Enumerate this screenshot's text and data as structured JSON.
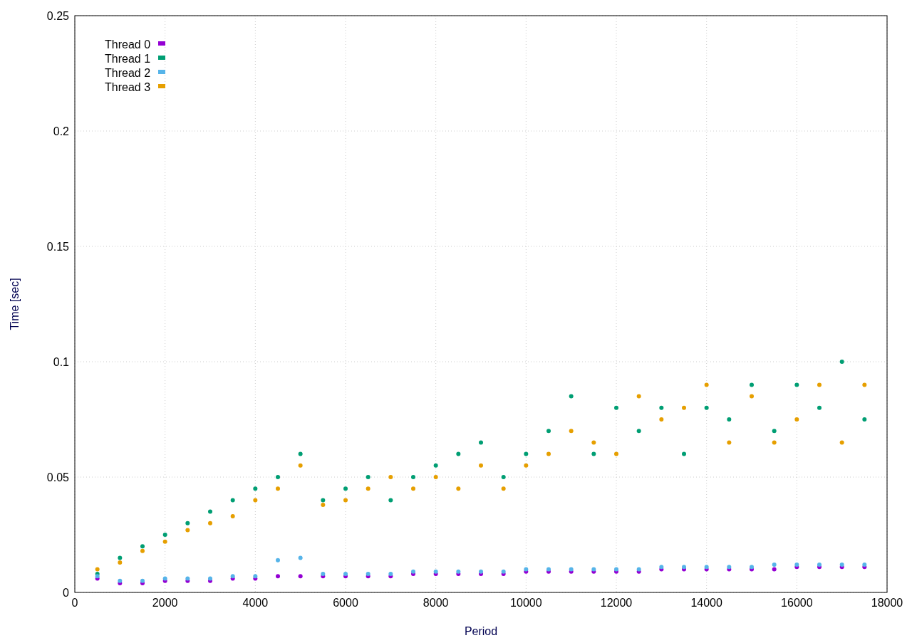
{
  "chart_data": {
    "type": "scatter",
    "grid": true,
    "legend": "upper left",
    "xlabel": "Period",
    "ylabel": "Time [sec]",
    "x": [
      500,
      1000,
      1500,
      2000,
      2500,
      3000,
      3500,
      4000,
      4500,
      5000,
      5500,
      6000,
      6500,
      7000,
      7500,
      8000,
      8500,
      9000,
      9500,
      10000,
      10500,
      11000,
      11500,
      12000,
      12500,
      13000,
      13500,
      14000,
      14500,
      15000,
      15500,
      16000,
      16500,
      17000,
      17500
    ],
    "series": [
      {
        "name": "Thread 0",
        "color": "#9400d3",
        "values": [
          0.006,
          0.004,
          0.004,
          0.005,
          0.005,
          0.005,
          0.006,
          0.006,
          0.007,
          0.007,
          0.007,
          0.007,
          0.007,
          0.007,
          0.008,
          0.008,
          0.008,
          0.008,
          0.008,
          0.009,
          0.009,
          0.009,
          0.009,
          0.009,
          0.009,
          0.01,
          0.01,
          0.01,
          0.01,
          0.01,
          0.01,
          0.011,
          0.011,
          0.011,
          0.011
        ]
      },
      {
        "name": "Thread 1",
        "color": "#009e73",
        "values": [
          0.008,
          0.015,
          0.02,
          0.025,
          0.03,
          0.035,
          0.04,
          0.045,
          0.05,
          0.06,
          0.04,
          0.045,
          0.05,
          0.04,
          0.05,
          0.055,
          0.06,
          0.065,
          0.05,
          0.06,
          0.07,
          0.085,
          0.06,
          0.08,
          0.07,
          0.08,
          0.06,
          0.08,
          0.075,
          0.09,
          0.07,
          0.09,
          0.08,
          0.1,
          0.075
        ]
      },
      {
        "name": "Thread 2",
        "color": "#56b4e9",
        "values": [
          0.007,
          0.005,
          0.005,
          0.006,
          0.006,
          0.006,
          0.007,
          0.007,
          0.014,
          0.015,
          0.008,
          0.008,
          0.008,
          0.008,
          0.009,
          0.009,
          0.009,
          0.009,
          0.009,
          0.01,
          0.01,
          0.01,
          0.01,
          0.01,
          0.01,
          0.011,
          0.011,
          0.011,
          0.011,
          0.011,
          0.012,
          0.012,
          0.012,
          0.012,
          0.012
        ]
      },
      {
        "name": "Thread 3",
        "color": "#e69f00",
        "values": [
          0.01,
          0.013,
          0.018,
          0.022,
          0.027,
          0.03,
          0.033,
          0.04,
          0.045,
          0.055,
          0.038,
          0.04,
          0.045,
          0.05,
          0.045,
          0.05,
          0.045,
          0.055,
          0.045,
          0.055,
          0.06,
          0.07,
          0.065,
          0.06,
          0.085,
          0.075,
          0.08,
          0.09,
          0.065,
          0.085,
          0.065,
          0.075,
          0.09,
          0.065,
          0.09
        ]
      }
    ],
    "xlim": [
      0,
      18000
    ],
    "ylim": [
      0,
      0.25
    ],
    "xticks": [
      0,
      2000,
      4000,
      6000,
      8000,
      10000,
      12000,
      14000,
      16000,
      18000
    ],
    "yticks": [
      {
        "value": 0,
        "label": "0"
      },
      {
        "value": 0.05,
        "label": "0.05"
      },
      {
        "value": 0.1,
        "label": "0.1"
      },
      {
        "value": 0.15,
        "label": "0.15"
      },
      {
        "value": 0.2,
        "label": "0.2"
      },
      {
        "value": 0.25,
        "label": "0.25"
      }
    ]
  }
}
